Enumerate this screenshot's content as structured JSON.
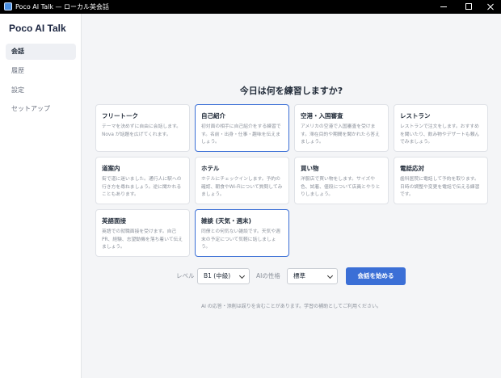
{
  "window": {
    "title": "Poco AI Talk — ローカル英会話"
  },
  "sidebar": {
    "brand": "Poco AI Talk",
    "items": [
      {
        "label": "会話",
        "active": true
      },
      {
        "label": "履歴",
        "active": false
      },
      {
        "label": "設定",
        "active": false
      },
      {
        "label": "セットアップ",
        "active": false
      }
    ]
  },
  "main": {
    "heading": "今日は何を練習しますか?",
    "scenarios": [
      {
        "title": "フリートーク",
        "desc": "テーマを決めずに自由に会話します。Nova が話題を広げてくれます。",
        "selected": false
      },
      {
        "title": "自己紹介",
        "desc": "初対面の相手に自己紹介をする練習です。名前・出身・仕事・趣味を伝えましょう。",
        "selected": true
      },
      {
        "title": "空港・入国審査",
        "desc": "アメリカの空港で入国審査を受けます。滞在目的や期間を聞かれたら答えましょう。",
        "selected": false
      },
      {
        "title": "レストラン",
        "desc": "レストランで注文をします。おすすめを聞いたり、飲み物やデザートも頼んでみましょう。",
        "selected": false
      },
      {
        "title": "道案内",
        "desc": "街で道に迷いました。通行人に駅への行き方を尋ねましょう。逆に聞かれることもあります。",
        "selected": false
      },
      {
        "title": "ホテル",
        "desc": "ホテルにチェックインします。予約の確認、朝食やWi-Fiについて質問してみましょう。",
        "selected": false
      },
      {
        "title": "買い物",
        "desc": "洋服店で買い物をします。サイズや色、試着、値段について店員とやりとりしましょう。",
        "selected": false
      },
      {
        "title": "電話応対",
        "desc": "歯科医院に電話して予約を取ります。日時の調整や変更を電話で伝える練習です。",
        "selected": false
      },
      {
        "title": "英語面接",
        "desc": "英語での就職面接を受けます。自己PR、経験、志望動機を落ち着いて伝えましょう。",
        "selected": false
      },
      {
        "title": "雑談 (天気・週末)",
        "desc": "同僚との何気ない雑談です。天気や週末の予定について気軽に話しましょう。",
        "selected": true
      }
    ],
    "controls": {
      "level_label": "レベル",
      "level_value": "B1 (中級)",
      "personality_label": "AIの性格",
      "personality_value": "標準",
      "start_label": "会話を始める"
    },
    "disclaimer": "AI の応答・添削は誤りを含むことがあります。学習の補助としてご利用ください。"
  },
  "colors": {
    "accent": "#3b6fd6",
    "background": "#f4f5f7"
  },
  "icons": [
    "app-icon",
    "minimize-icon",
    "maximize-icon",
    "close-icon",
    "chevron-down-icon"
  ]
}
